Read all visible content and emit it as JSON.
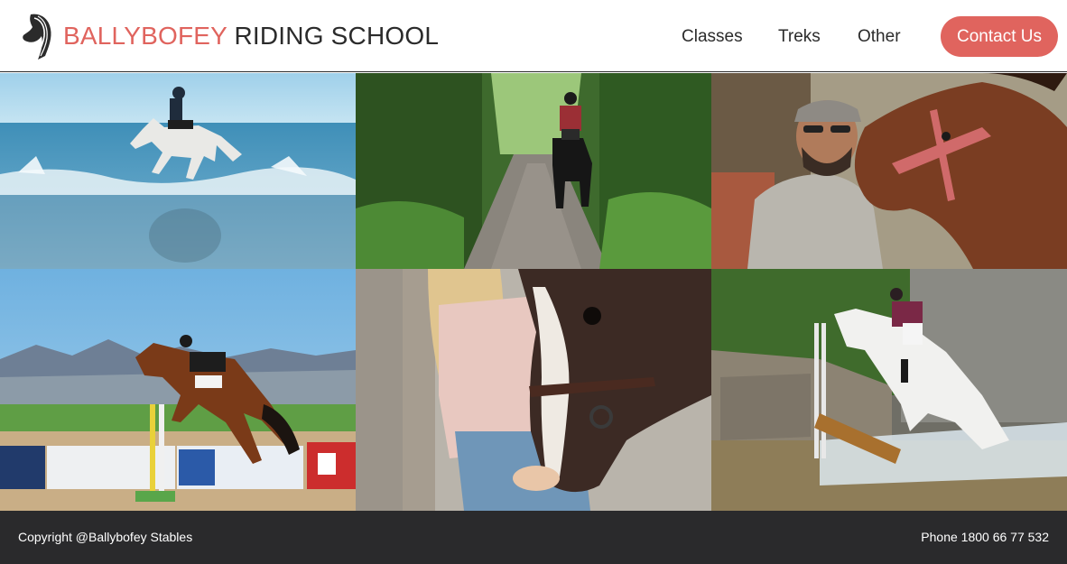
{
  "header": {
    "brand_accent": "BALLYBOFEY",
    "brand_rest": "RIDING SCHOOL",
    "logo_icon": "horse-head-icon"
  },
  "nav": {
    "items": [
      {
        "label": "Classes"
      },
      {
        "label": "Treks"
      },
      {
        "label": "Other"
      }
    ],
    "cta_label": "Contact Us"
  },
  "gallery": {
    "images": [
      {
        "name": "beach-gallop-photo"
      },
      {
        "name": "forest-trail-photo"
      },
      {
        "name": "man-with-horse-photo"
      },
      {
        "name": "show-jumping-photo"
      },
      {
        "name": "girl-with-horse-photo"
      },
      {
        "name": "cross-country-water-photo"
      }
    ]
  },
  "footer": {
    "copyright": "Copyright @Ballybofey Stables",
    "phone": "Phone 1800 66 77 532"
  },
  "colors": {
    "accent": "#e0645e",
    "text": "#2b2b2b",
    "footer_bg": "#2a2a2c"
  }
}
